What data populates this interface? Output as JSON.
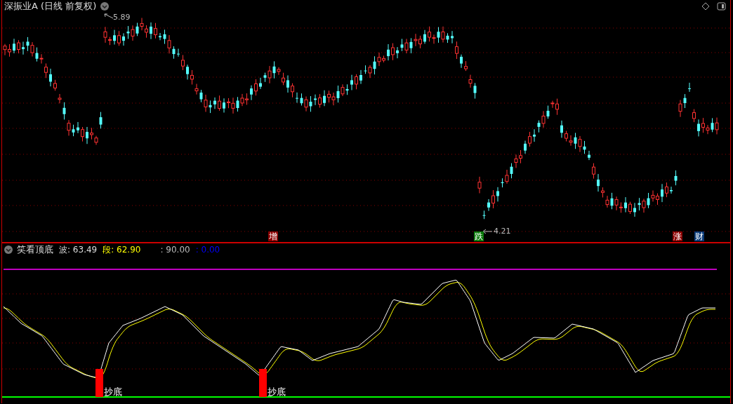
{
  "title": "深振业A (日线 前复权)",
  "price_marks": [
    {
      "text": "5.89"
    },
    {
      "text": "4.21"
    }
  ],
  "events": [
    {
      "label": "增",
      "color": "#8b0000"
    },
    {
      "label": "跌",
      "color": "#0a7a0a"
    },
    {
      "label": "涨",
      "color": "#8b0000"
    },
    {
      "label": "财",
      "color": "#0b3a78"
    }
  ],
  "indicator": {
    "name": "笑看顶底",
    "readouts": [
      {
        "text": "波: 63.49",
        "color": "#dddddd"
      },
      {
        "text": "段: 62.90",
        "color": "#ffff00"
      },
      {
        "text": ": 90.00",
        "color": "#bbbbbb"
      },
      {
        "text": ": 0.00",
        "color": "#0000ff"
      }
    ]
  },
  "signals": [
    {
      "label": "抄底"
    },
    {
      "label": "抄底"
    }
  ]
}
